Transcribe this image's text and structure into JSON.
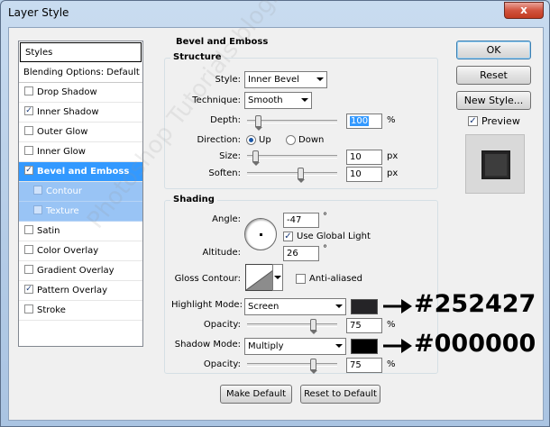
{
  "window": {
    "title": "Layer Style",
    "close_glyph": "x"
  },
  "styles_list": {
    "header": "Styles",
    "blending": "Blending Options: Default",
    "items": [
      {
        "label": "Drop Shadow",
        "checked": false
      },
      {
        "label": "Inner Shadow",
        "checked": true
      },
      {
        "label": "Outer Glow",
        "checked": false
      },
      {
        "label": "Inner Glow",
        "checked": false
      },
      {
        "label": "Bevel and Emboss",
        "checked": true,
        "selected": true
      },
      {
        "label": "Contour",
        "checked": false,
        "sub": true
      },
      {
        "label": "Texture",
        "checked": false,
        "sub": true
      },
      {
        "label": "Satin",
        "checked": false
      },
      {
        "label": "Color Overlay",
        "checked": false
      },
      {
        "label": "Gradient Overlay",
        "checked": false
      },
      {
        "label": "Pattern Overlay",
        "checked": true
      },
      {
        "label": "Stroke",
        "checked": false
      }
    ]
  },
  "bevel": {
    "group_title": "Bevel and Emboss",
    "structure_title": "Structure",
    "style_label": "Style:",
    "style_value": "Inner Bevel",
    "technique_label": "Technique:",
    "technique_value": "Smooth",
    "depth_label": "Depth:",
    "depth_value": "100",
    "depth_unit": "%",
    "depth_fraction": 0.1,
    "direction_label": "Direction:",
    "direction_up": "Up",
    "direction_down": "Down",
    "size_label": "Size:",
    "size_value": "10",
    "size_unit": "px",
    "size_fraction": 0.06,
    "soften_label": "Soften:",
    "soften_value": "10",
    "soften_unit": "px",
    "soften_fraction": 0.6
  },
  "shading": {
    "title": "Shading",
    "angle_label": "Angle:",
    "angle_value": "-47",
    "angle_unit": "°",
    "global_light": "Use Global Light",
    "altitude_label": "Altitude:",
    "altitude_value": "26",
    "altitude_unit": "°",
    "gloss_label": "Gloss Contour:",
    "anti_aliased": "Anti-aliased",
    "highlight_label": "Highlight Mode:",
    "highlight_mode": "Screen",
    "highlight_color": "#252427",
    "highlight_opacity_label": "Opacity:",
    "highlight_opacity": "75",
    "highlight_opacity_unit": "%",
    "shadow_label": "Shadow Mode:",
    "shadow_mode": "Multiply",
    "shadow_color": "#000000",
    "shadow_opacity_label": "Opacity:",
    "shadow_opacity": "75",
    "shadow_opacity_unit": "%",
    "opacity_fraction": 0.75
  },
  "buttons": {
    "make_default": "Make Default",
    "reset_default": "Reset to Default",
    "ok": "OK",
    "reset": "Reset",
    "new_style": "New Style...",
    "preview": "Preview"
  },
  "annotations": {
    "highlight_hex": "#252427",
    "shadow_hex": "#000000"
  },
  "watermark": "Photoshop Tutorials blogspot.com"
}
